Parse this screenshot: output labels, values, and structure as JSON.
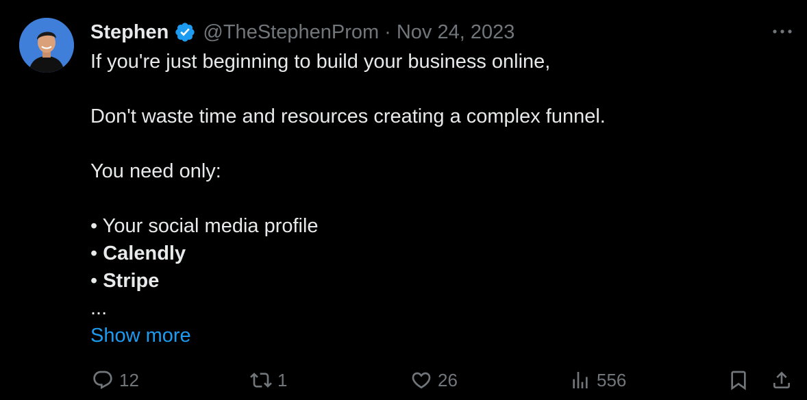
{
  "tweet": {
    "author": {
      "display_name": "Stephen",
      "handle": "@TheStephenProm",
      "verified": true
    },
    "separator": "·",
    "date": "Nov 24, 2023",
    "lines": [
      "If you're just beginning to build your business online,",
      "",
      "Don't waste time and resources creating a complex funnel.",
      "",
      "You need only:",
      "",
      "• Your social media profile"
    ],
    "bullets_bold": [
      {
        "bullet": "• ",
        "text": "Calendly"
      },
      {
        "bullet": "• ",
        "text": "Stripe"
      }
    ],
    "ellipsis": "...",
    "show_more": "Show more",
    "metrics": {
      "replies": "12",
      "reposts": "1",
      "likes": "26",
      "views": "556"
    }
  },
  "colors": {
    "background": "#000000",
    "text_primary": "#e7e9ea",
    "text_secondary": "#71767b",
    "accent": "#1d9bf0",
    "verified": "#1d9bf0",
    "avatar_bg": "#3f7fd9"
  },
  "icons": [
    "verified-badge-icon",
    "more-icon",
    "reply-icon",
    "repost-icon",
    "like-icon",
    "views-icon",
    "bookmark-icon",
    "share-icon"
  ]
}
